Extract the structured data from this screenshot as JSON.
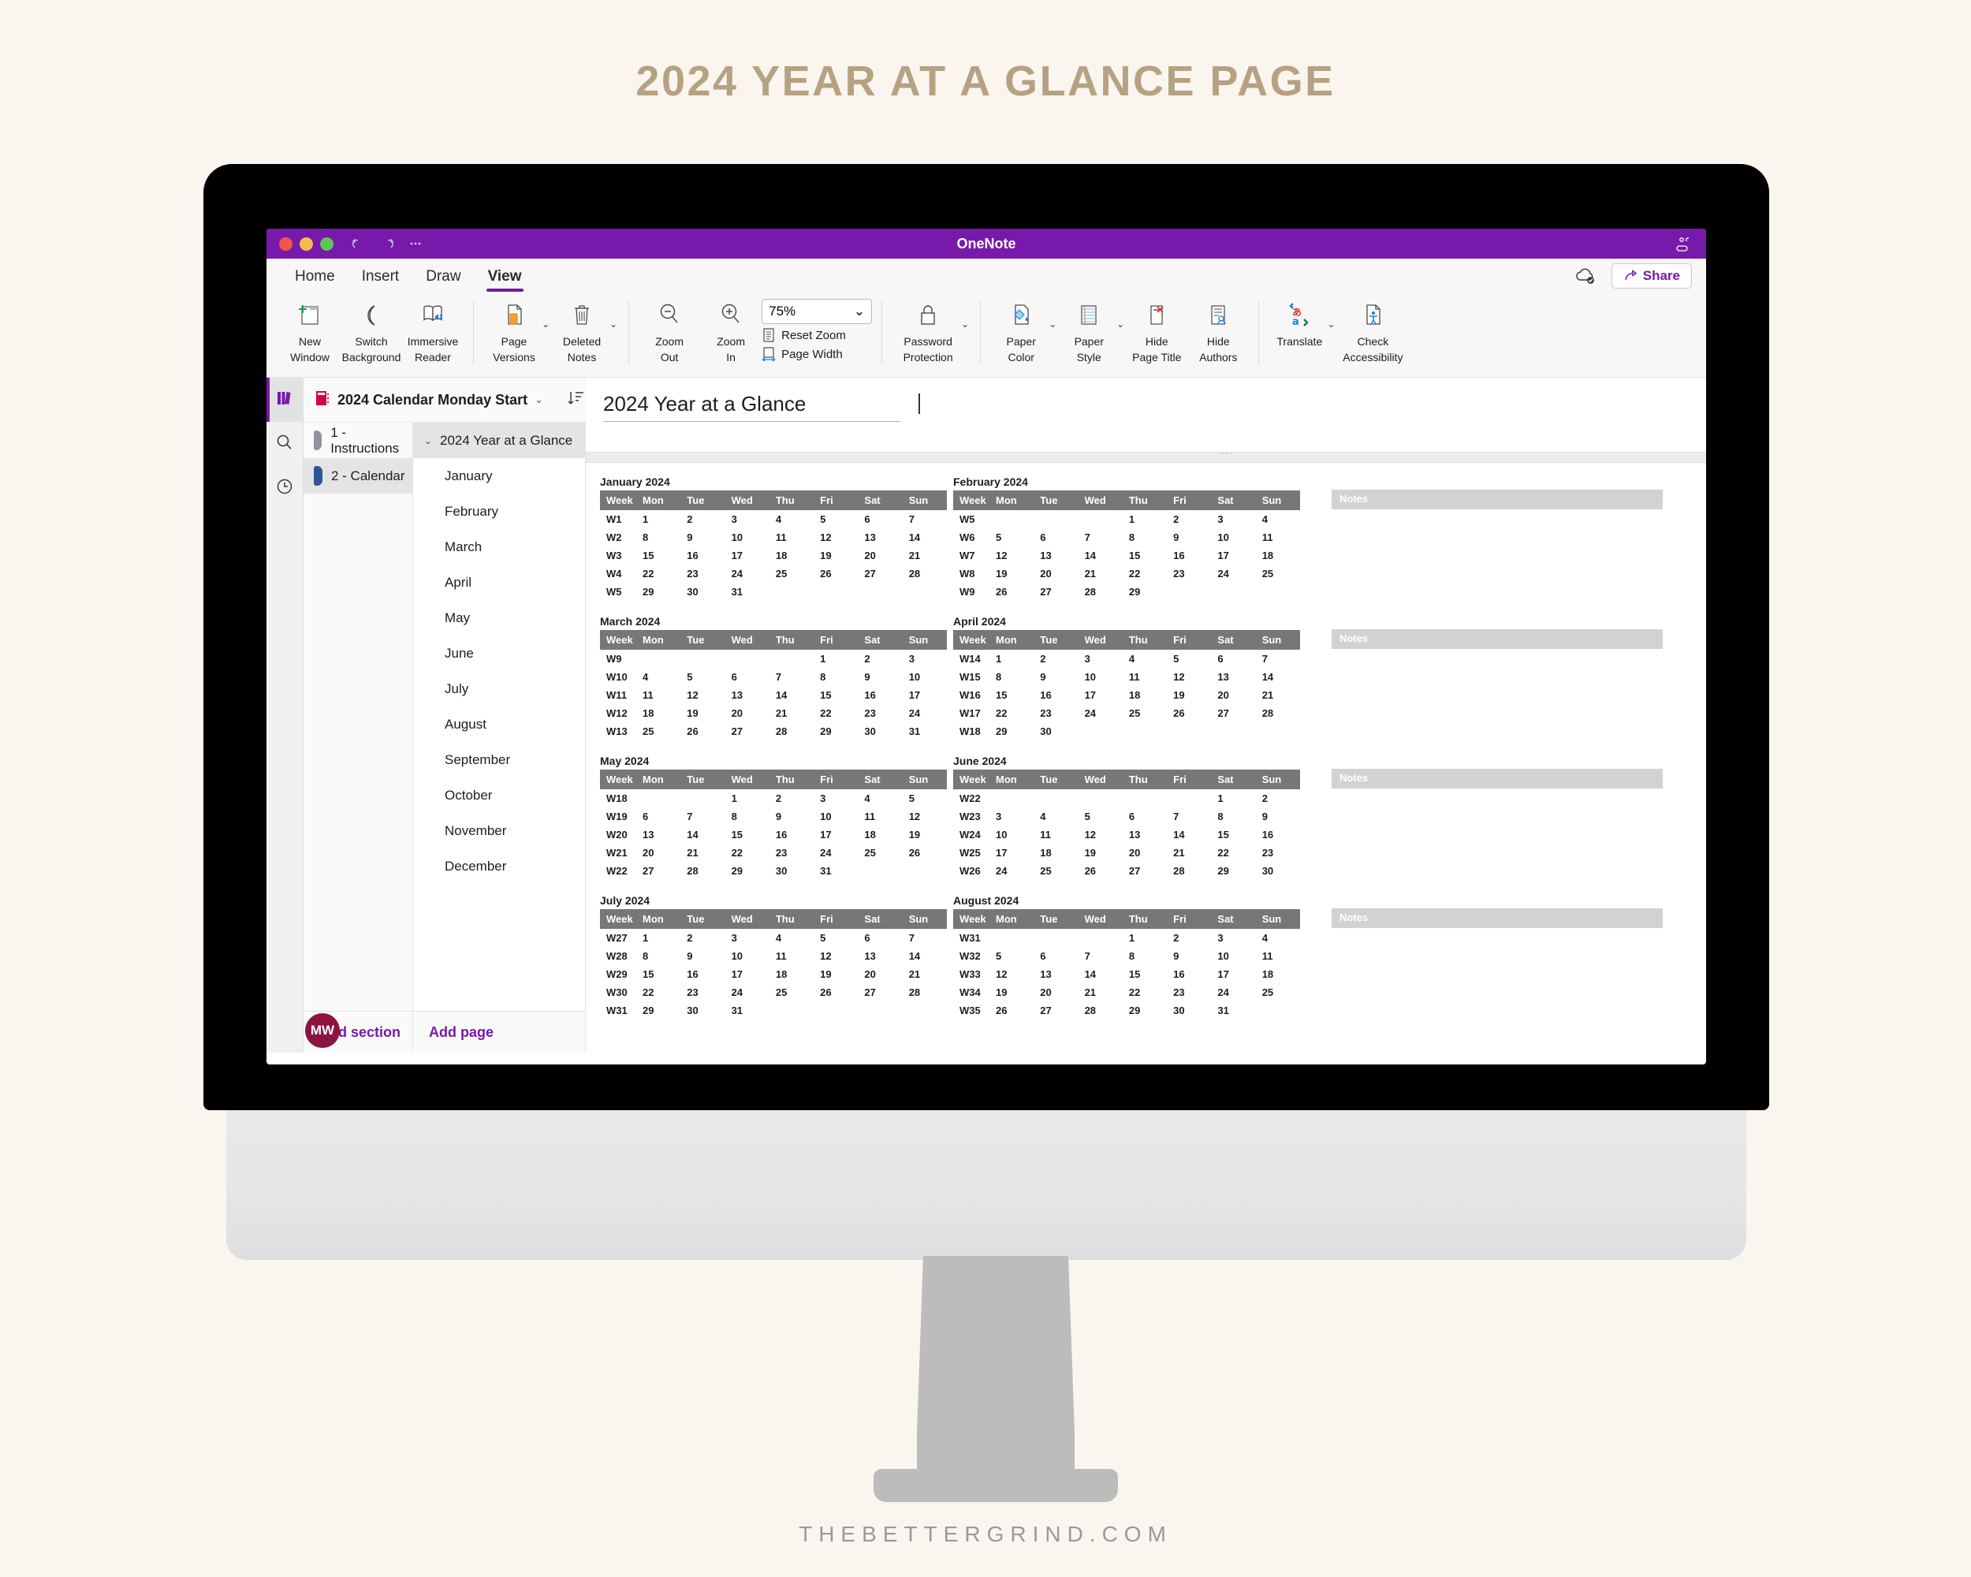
{
  "poster": {
    "title": "2024 YEAR AT A GLANCE PAGE",
    "watermark": "THEBETTERGRIND.COM",
    "title_color": "#b6a283",
    "background": "#faf5ee"
  },
  "window": {
    "app_title": "OneNote",
    "accent_color": "#7719aa",
    "traffic_lights": [
      "close-red",
      "minimize-yellow",
      "maximize-green"
    ],
    "undo_label": "Undo",
    "redo_label": "Redo",
    "more_label": "More",
    "sidebar_toggle_label": "Sidebar"
  },
  "ribbon": {
    "tabs": [
      {
        "label": "Home",
        "active": false
      },
      {
        "label": "Insert",
        "active": false
      },
      {
        "label": "Draw",
        "active": false
      },
      {
        "label": "View",
        "active": true
      }
    ],
    "share_label": "Share",
    "sync_status_label": "Synced",
    "groups": [
      {
        "items": [
          {
            "label_line1": "New",
            "label_line2": "Window",
            "icon": "new-window-icon",
            "dropdown": false
          },
          {
            "label_line1": "Switch",
            "label_line2": "Background",
            "icon": "switch-background-icon",
            "dropdown": false
          },
          {
            "label_line1": "Immersive",
            "label_line2": "Reader",
            "icon": "immersive-reader-icon",
            "dropdown": false
          }
        ]
      },
      {
        "items": [
          {
            "label_line1": "Page",
            "label_line2": "Versions",
            "icon": "page-versions-icon",
            "dropdown": true
          },
          {
            "label_line1": "Deleted",
            "label_line2": "Notes",
            "icon": "deleted-notes-icon",
            "dropdown": true
          }
        ]
      },
      {
        "items": [
          {
            "label_line1": "Zoom",
            "label_line2": "Out",
            "icon": "zoom-out-icon",
            "dropdown": false
          },
          {
            "label_line1": "Zoom",
            "label_line2": "In",
            "icon": "zoom-in-icon",
            "dropdown": false
          }
        ],
        "zoom_value": "75%",
        "reset_zoom_label": "Reset Zoom",
        "page_width_label": "Page Width"
      },
      {
        "items": [
          {
            "label_line1": "Password",
            "label_line2": "Protection",
            "icon": "lock-icon",
            "dropdown": true
          }
        ]
      },
      {
        "items": [
          {
            "label_line1": "Paper",
            "label_line2": "Color",
            "icon": "paper-color-icon",
            "dropdown": true
          },
          {
            "label_line1": "Paper",
            "label_line2": "Style",
            "icon": "paper-style-icon",
            "dropdown": true
          },
          {
            "label_line1": "Hide",
            "label_line2": "Page Title",
            "icon": "hide-page-title-icon",
            "dropdown": false
          },
          {
            "label_line1": "Hide",
            "label_line2": "Authors",
            "icon": "hide-authors-icon",
            "dropdown": false
          }
        ]
      },
      {
        "items": [
          {
            "label_line1": "Translate",
            "label_line2": "",
            "icon": "translate-icon",
            "dropdown": true
          },
          {
            "label_line1": "Check",
            "label_line2": "Accessibility",
            "icon": "check-accessibility-icon",
            "dropdown": false
          }
        ]
      }
    ]
  },
  "rail": {
    "items": [
      {
        "name": "notebooks-icon",
        "active": true
      },
      {
        "name": "search-icon",
        "active": false
      },
      {
        "name": "recent-notes-icon",
        "active": false
      }
    ]
  },
  "notebook": {
    "name": "2024 Calendar Monday Start",
    "sort_label": "Sort",
    "sections": [
      {
        "label": "1 - Instructions",
        "color": "#8e9499",
        "active": false
      },
      {
        "label": "2 - Calendar",
        "color": "#2b5797",
        "active": true
      }
    ],
    "add_section_label": "Add section",
    "user_initials": "MW"
  },
  "pages": {
    "items": [
      {
        "label": "2024 Year at a Glance",
        "active": true,
        "expandable": true,
        "sub": false
      },
      {
        "label": "January",
        "active": false,
        "expandable": false,
        "sub": true
      },
      {
        "label": "February",
        "active": false,
        "expandable": false,
        "sub": true
      },
      {
        "label": "March",
        "active": false,
        "expandable": false,
        "sub": true
      },
      {
        "label": "April",
        "active": false,
        "expandable": false,
        "sub": true
      },
      {
        "label": "May",
        "active": false,
        "expandable": false,
        "sub": true
      },
      {
        "label": "June",
        "active": false,
        "expandable": false,
        "sub": true
      },
      {
        "label": "July",
        "active": false,
        "expandable": false,
        "sub": true
      },
      {
        "label": "August",
        "active": false,
        "expandable": false,
        "sub": true
      },
      {
        "label": "September",
        "active": false,
        "expandable": false,
        "sub": true
      },
      {
        "label": "October",
        "active": false,
        "expandable": false,
        "sub": true
      },
      {
        "label": "November",
        "active": false,
        "expandable": false,
        "sub": true
      },
      {
        "label": "December",
        "active": false,
        "expandable": false,
        "sub": true
      }
    ],
    "add_page_label": "Add page"
  },
  "canvas": {
    "page_title": "2024 Year at a Glance",
    "notes_label": "Notes",
    "columns": [
      "Week",
      "Mon",
      "Tue",
      "Wed",
      "Thu",
      "Fri",
      "Sat",
      "Sun"
    ],
    "header_bg": "#777777",
    "notes_bg": "#d2d2d2",
    "months": [
      {
        "name": "January 2024",
        "rows": [
          [
            "W1",
            "1",
            "2",
            "3",
            "4",
            "5",
            "6",
            "7"
          ],
          [
            "W2",
            "8",
            "9",
            "10",
            "11",
            "12",
            "13",
            "14"
          ],
          [
            "W3",
            "15",
            "16",
            "17",
            "18",
            "19",
            "20",
            "21"
          ],
          [
            "W4",
            "22",
            "23",
            "24",
            "25",
            "26",
            "27",
            "28"
          ],
          [
            "W5",
            "29",
            "30",
            "31",
            "",
            "",
            "",
            ""
          ]
        ]
      },
      {
        "name": "February 2024",
        "rows": [
          [
            "W5",
            "",
            "",
            "",
            "1",
            "2",
            "3",
            "4"
          ],
          [
            "W6",
            "5",
            "6",
            "7",
            "8",
            "9",
            "10",
            "11"
          ],
          [
            "W7",
            "12",
            "13",
            "14",
            "15",
            "16",
            "17",
            "18"
          ],
          [
            "W8",
            "19",
            "20",
            "21",
            "22",
            "23",
            "24",
            "25"
          ],
          [
            "W9",
            "26",
            "27",
            "28",
            "29",
            "",
            "",
            ""
          ]
        ]
      },
      {
        "name": "March 2024",
        "rows": [
          [
            "W9",
            "",
            "",
            "",
            "",
            "1",
            "2",
            "3"
          ],
          [
            "W10",
            "4",
            "5",
            "6",
            "7",
            "8",
            "9",
            "10"
          ],
          [
            "W11",
            "11",
            "12",
            "13",
            "14",
            "15",
            "16",
            "17"
          ],
          [
            "W12",
            "18",
            "19",
            "20",
            "21",
            "22",
            "23",
            "24"
          ],
          [
            "W13",
            "25",
            "26",
            "27",
            "28",
            "29",
            "30",
            "31"
          ]
        ]
      },
      {
        "name": "April 2024",
        "rows": [
          [
            "W14",
            "1",
            "2",
            "3",
            "4",
            "5",
            "6",
            "7"
          ],
          [
            "W15",
            "8",
            "9",
            "10",
            "11",
            "12",
            "13",
            "14"
          ],
          [
            "W16",
            "15",
            "16",
            "17",
            "18",
            "19",
            "20",
            "21"
          ],
          [
            "W17",
            "22",
            "23",
            "24",
            "25",
            "26",
            "27",
            "28"
          ],
          [
            "W18",
            "29",
            "30",
            "",
            "",
            "",
            "",
            ""
          ]
        ]
      },
      {
        "name": "May 2024",
        "rows": [
          [
            "W18",
            "",
            "",
            "1",
            "2",
            "3",
            "4",
            "5"
          ],
          [
            "W19",
            "6",
            "7",
            "8",
            "9",
            "10",
            "11",
            "12"
          ],
          [
            "W20",
            "13",
            "14",
            "15",
            "16",
            "17",
            "18",
            "19"
          ],
          [
            "W21",
            "20",
            "21",
            "22",
            "23",
            "24",
            "25",
            "26"
          ],
          [
            "W22",
            "27",
            "28",
            "29",
            "30",
            "31",
            "",
            ""
          ]
        ]
      },
      {
        "name": "June 2024",
        "rows": [
          [
            "W22",
            "",
            "",
            "",
            "",
            "",
            "1",
            "2"
          ],
          [
            "W23",
            "3",
            "4",
            "5",
            "6",
            "7",
            "8",
            "9"
          ],
          [
            "W24",
            "10",
            "11",
            "12",
            "13",
            "14",
            "15",
            "16"
          ],
          [
            "W25",
            "17",
            "18",
            "19",
            "20",
            "21",
            "22",
            "23"
          ],
          [
            "W26",
            "24",
            "25",
            "26",
            "27",
            "28",
            "29",
            "30"
          ]
        ]
      },
      {
        "name": "July 2024",
        "rows": [
          [
            "W27",
            "1",
            "2",
            "3",
            "4",
            "5",
            "6",
            "7"
          ],
          [
            "W28",
            "8",
            "9",
            "10",
            "11",
            "12",
            "13",
            "14"
          ],
          [
            "W29",
            "15",
            "16",
            "17",
            "18",
            "19",
            "20",
            "21"
          ],
          [
            "W30",
            "22",
            "23",
            "24",
            "25",
            "26",
            "27",
            "28"
          ],
          [
            "W31",
            "29",
            "30",
            "31",
            "",
            "",
            "",
            ""
          ]
        ]
      },
      {
        "name": "August 2024",
        "rows": [
          [
            "W31",
            "",
            "",
            "",
            "1",
            "2",
            "3",
            "4"
          ],
          [
            "W32",
            "5",
            "6",
            "7",
            "8",
            "9",
            "10",
            "11"
          ],
          [
            "W33",
            "12",
            "13",
            "14",
            "15",
            "16",
            "17",
            "18"
          ],
          [
            "W34",
            "19",
            "20",
            "21",
            "22",
            "23",
            "24",
            "25"
          ],
          [
            "W35",
            "26",
            "27",
            "28",
            "29",
            "30",
            "31",
            ""
          ]
        ]
      }
    ]
  }
}
